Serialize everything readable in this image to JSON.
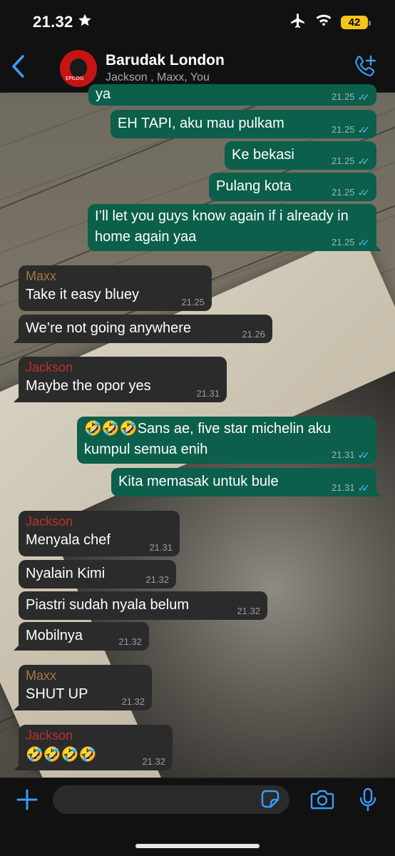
{
  "status_bar": {
    "time": "21.32",
    "battery": "42"
  },
  "header": {
    "group_name": "Barudak London",
    "members": "Jackson , Maxx, You"
  },
  "messages": [
    {
      "text": "ya",
      "time": "21.25"
    },
    {
      "text": "EH TAPI, aku mau pulkam",
      "time": "21.25"
    },
    {
      "text": "Ke bekasi",
      "time": "21.25"
    },
    {
      "text": "Pulang kota",
      "time": "21.25"
    },
    {
      "text": "I’ll let you guys know again if i already in home again yaa",
      "time": "21.25"
    },
    {
      "sender": "Maxx",
      "text": "Take it easy bluey",
      "time": "21.25"
    },
    {
      "text": "We’re not going anywhere",
      "time": "21.26"
    },
    {
      "sender": "Jackson",
      "text": "Maybe the opor yes",
      "time": "21.31"
    },
    {
      "text": "🤣🤣🤣Sans ae, five star michelin aku kumpul semua enih",
      "time": "21.31"
    },
    {
      "text": "Kita memasak untuk bule",
      "time": "21.31"
    },
    {
      "sender": "Jackson",
      "text": "Menyala chef",
      "time": "21.31"
    },
    {
      "text": "Nyalain Kimi",
      "time": "21.32"
    },
    {
      "text": "Piastri sudah nyala belum",
      "time": "21.32"
    },
    {
      "text": "Mobilnya",
      "time": "21.32"
    },
    {
      "sender": "Maxx",
      "text": "SHUT UP",
      "time": "21.32"
    },
    {
      "sender": "Jackson",
      "text": "🤣🤣🤣🤣",
      "time": "21.32"
    }
  ],
  "composer": {
    "placeholder": ""
  },
  "colors": {
    "outgoing_bubble": "#0b5f4b",
    "incoming_bubble": "#2b2b2b",
    "accent": "#3b9cf5",
    "read_ticks": "#53bdeb"
  },
  "icons": [
    "star-icon",
    "airplane-icon",
    "wifi-icon",
    "back-chevron-icon",
    "add-call-icon",
    "plus-icon",
    "sticker-icon",
    "camera-icon",
    "microphone-icon"
  ]
}
